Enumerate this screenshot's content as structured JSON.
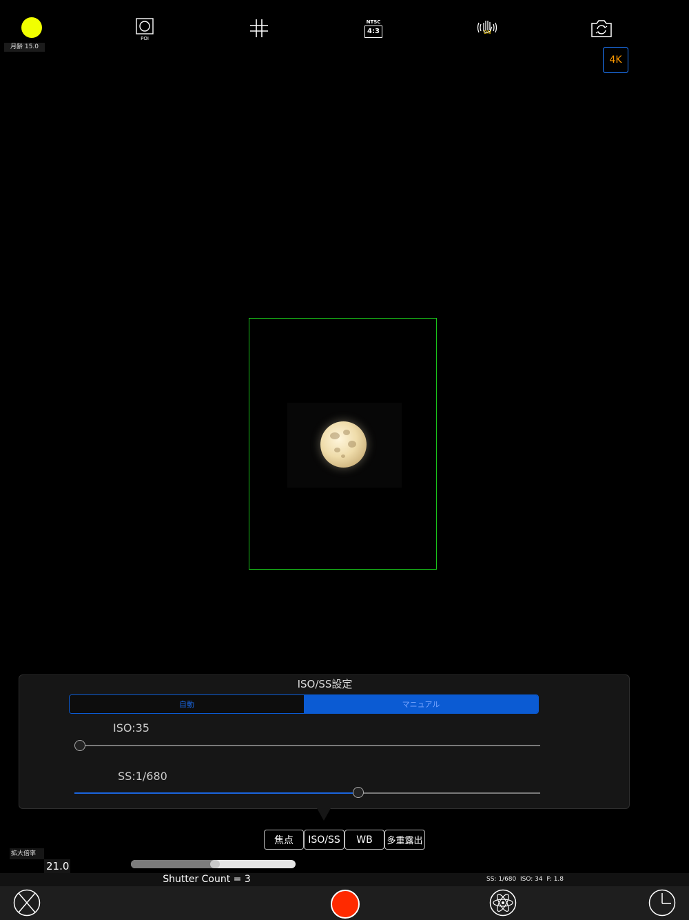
{
  "top_bar": {
    "moon_age": "月齢 15.0",
    "poi_label": "POI",
    "aspect_top": "NTSC",
    "aspect_ratio": "4:3",
    "stabilizer_state": "ON",
    "resolution_badge": "4K"
  },
  "colors": {
    "moon_phase": "#f1ff00",
    "focus_frame": "#19c21a",
    "accent": "#0b5bd3",
    "record": "#ff2a00",
    "badge_text": "#ff9a00"
  },
  "panel": {
    "title": "ISO/SS設定",
    "mode_auto": "自動",
    "mode_manual": "マニュアル",
    "selected_mode": "マニュアル",
    "iso_label": "ISO:35",
    "ss_label": "SS:1/680",
    "iso_slider_fraction": 0.01,
    "ss_slider_fraction": 0.61
  },
  "tabs": [
    "焦点",
    "ISO/SS",
    "WB",
    "多重露出"
  ],
  "selected_tab": "ISO/SS",
  "zoom": {
    "label": "拡大倍率",
    "value": "21.0",
    "slider_fraction": 0.51
  },
  "info": {
    "shutter_count": "Shutter Count = 3",
    "exposure": "SS: 1/680  ISO: 34  F: 1.8"
  },
  "icons": {
    "close": "close-x-icon",
    "record": "record-icon",
    "effects": "atom-icon",
    "timer": "clock-icon"
  }
}
